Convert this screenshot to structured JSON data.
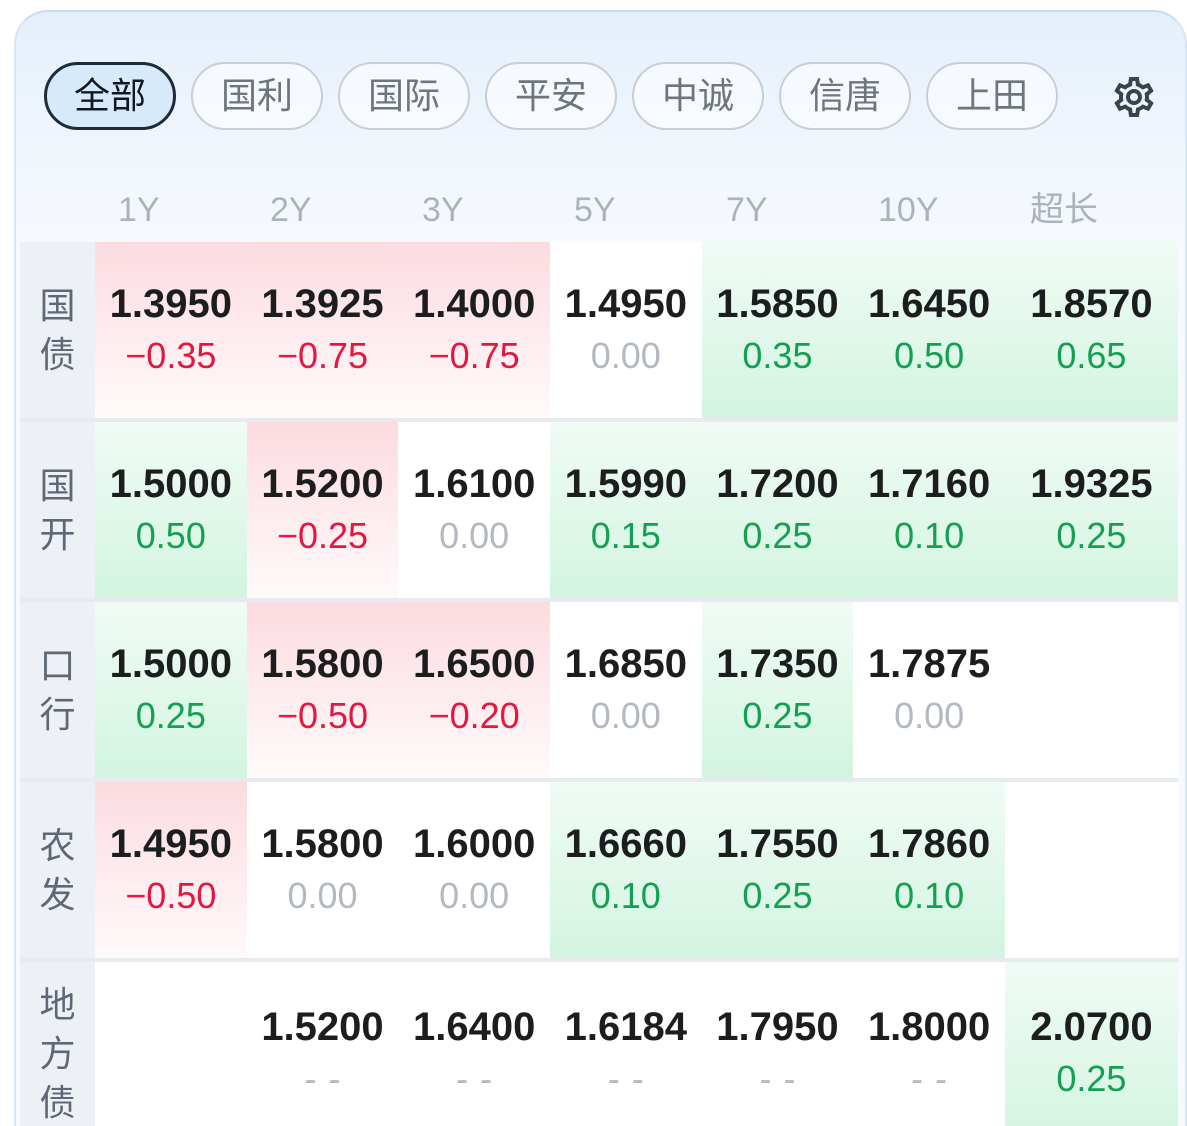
{
  "filters": [
    {
      "label": "全部",
      "selected": true
    },
    {
      "label": "国利",
      "selected": false
    },
    {
      "label": "国际",
      "selected": false
    },
    {
      "label": "平安",
      "selected": false
    },
    {
      "label": "中诚",
      "selected": false
    },
    {
      "label": "信唐",
      "selected": false
    },
    {
      "label": "上田",
      "selected": false
    }
  ],
  "settings": {
    "icon": "gear-icon"
  },
  "columns": [
    "1Y",
    "2Y",
    "3Y",
    "5Y",
    "7Y",
    "10Y",
    "超长"
  ],
  "rows": [
    {
      "label": "国债",
      "cells": [
        {
          "value": "1.3950",
          "change": "−0.35",
          "trend": "down"
        },
        {
          "value": "1.3925",
          "change": "−0.75",
          "trend": "down"
        },
        {
          "value": "1.4000",
          "change": "−0.75",
          "trend": "down"
        },
        {
          "value": "1.4950",
          "change": "0.00",
          "trend": "flat"
        },
        {
          "value": "1.5850",
          "change": "0.35",
          "trend": "up"
        },
        {
          "value": "1.6450",
          "change": "0.50",
          "trend": "up"
        },
        {
          "value": "1.8570",
          "change": "0.65",
          "trend": "up"
        }
      ]
    },
    {
      "label": "国开",
      "cells": [
        {
          "value": "1.5000",
          "change": "0.50",
          "trend": "up"
        },
        {
          "value": "1.5200",
          "change": "−0.25",
          "trend": "down"
        },
        {
          "value": "1.6100",
          "change": "0.00",
          "trend": "flat"
        },
        {
          "value": "1.5990",
          "change": "0.15",
          "trend": "up"
        },
        {
          "value": "1.7200",
          "change": "0.25",
          "trend": "up"
        },
        {
          "value": "1.7160",
          "change": "0.10",
          "trend": "up"
        },
        {
          "value": "1.9325",
          "change": "0.25",
          "trend": "up"
        }
      ]
    },
    {
      "label": "口行",
      "cells": [
        {
          "value": "1.5000",
          "change": "0.25",
          "trend": "up"
        },
        {
          "value": "1.5800",
          "change": "−0.50",
          "trend": "down"
        },
        {
          "value": "1.6500",
          "change": "−0.20",
          "trend": "down"
        },
        {
          "value": "1.6850",
          "change": "0.00",
          "trend": "flat"
        },
        {
          "value": "1.7350",
          "change": "0.25",
          "trend": "up"
        },
        {
          "value": "1.7875",
          "change": "0.00",
          "trend": "flat"
        },
        null
      ]
    },
    {
      "label": "农发",
      "cells": [
        {
          "value": "1.4950",
          "change": "−0.50",
          "trend": "down"
        },
        {
          "value": "1.5800",
          "change": "0.00",
          "trend": "flat"
        },
        {
          "value": "1.6000",
          "change": "0.00",
          "trend": "flat"
        },
        {
          "value": "1.6660",
          "change": "0.10",
          "trend": "up"
        },
        {
          "value": "1.7550",
          "change": "0.25",
          "trend": "up"
        },
        {
          "value": "1.7860",
          "change": "0.10",
          "trend": "up"
        },
        null
      ]
    },
    {
      "label": "地方债",
      "cells": [
        null,
        {
          "value": "1.5200",
          "change": "--",
          "trend": "na"
        },
        {
          "value": "1.6400",
          "change": "--",
          "trend": "na"
        },
        {
          "value": "1.6184",
          "change": "--",
          "trend": "na"
        },
        {
          "value": "1.7950",
          "change": "--",
          "trend": "na"
        },
        {
          "value": "1.8000",
          "change": "--",
          "trend": "na"
        },
        {
          "value": "2.0700",
          "change": "0.25",
          "trend": "up"
        }
      ]
    }
  ],
  "colors": {
    "negative": "#e5163f",
    "positive": "#14a053",
    "neutral": "#b3b9c0",
    "selected_chip": "#d6eafb"
  }
}
